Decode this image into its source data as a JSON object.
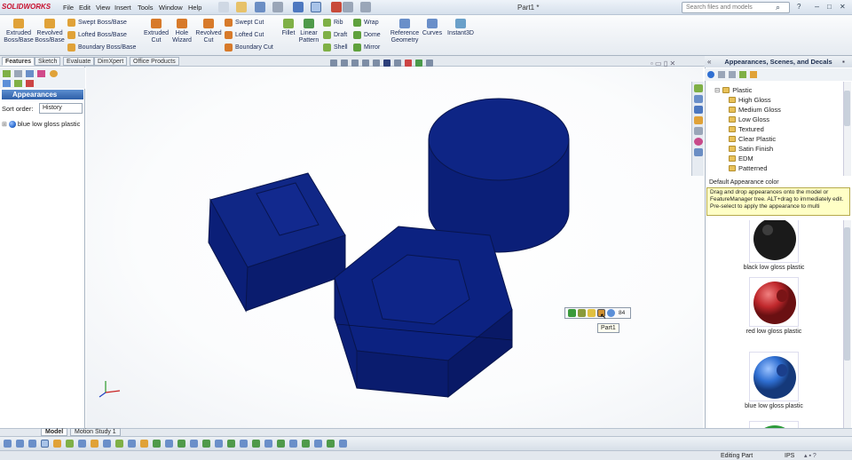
{
  "app": {
    "logo": "SOLIDWORKS",
    "title": "Part1 *"
  },
  "menu": [
    "File",
    "Edit",
    "View",
    "Insert",
    "Tools",
    "Window",
    "Help"
  ],
  "search": {
    "placeholder": "Search files and models"
  },
  "commands": {
    "big": [
      {
        "label": "Extruded\nBoss/Base",
        "icon": "extrude-boss-icon"
      },
      {
        "label": "Revolved\nBoss/Base",
        "icon": "revolve-boss-icon"
      }
    ],
    "col1": [
      "Swept Boss/Base",
      "Lofted Boss/Base",
      "Boundary Boss/Base"
    ],
    "big2": [
      {
        "label": "Extruded\nCut",
        "icon": "extrude-cut-icon"
      },
      {
        "label": "Hole\nWizard",
        "icon": "hole-wizard-icon"
      },
      {
        "label": "Revolved\nCut",
        "icon": "revolve-cut-icon"
      }
    ],
    "col2": [
      "Swept Cut",
      "Lofted Cut",
      "Boundary Cut"
    ],
    "fillet": "Fillet",
    "linear": "Linear\nPattern",
    "col3": [
      "Rib",
      "Draft",
      "Shell"
    ],
    "col4": [
      "Wrap",
      "Dome",
      "Mirror"
    ],
    "refgeo": "Reference\nGeometry",
    "curves": "Curves",
    "instant3d": "Instant3D"
  },
  "tabs": [
    "Features",
    "Sketch",
    "Evaluate",
    "DimXpert",
    "Office Products"
  ],
  "left": {
    "header": "Appearances",
    "sort_label": "Sort order:",
    "sort_value": "History",
    "item": "blue low gloss plastic"
  },
  "context": {
    "tooltip": "Part1",
    "extra": "84"
  },
  "right": {
    "title": "Appearances, Scenes, and Decals",
    "tree_root": "Plastic",
    "tree_items": [
      "High Gloss",
      "Medium Gloss",
      "Low Gloss",
      "Textured",
      "Clear Plastic",
      "Satin Finish",
      "EDM",
      "Patterned"
    ],
    "default_label": "Default Appearance  color",
    "tooltip": "Drag and drop appearances onto the model or FeatureManager tree.  ALT+drag to immediately edit.  Pre-select to apply the appearance to multi",
    "swatches": [
      {
        "label": "black low gloss plastic",
        "color": "#1a1a1a"
      },
      {
        "label": "red low gloss plastic",
        "color": "#c0282c"
      },
      {
        "label": "blue low gloss plastic",
        "color": "#2f6fd2"
      }
    ]
  },
  "bottom_tabs": [
    "Model",
    "Motion Study 1"
  ],
  "status": {
    "mode": "Editing Part",
    "units": "IPS"
  },
  "colors": {
    "model": "#0b1f78",
    "accent": "#2e5fa8"
  }
}
